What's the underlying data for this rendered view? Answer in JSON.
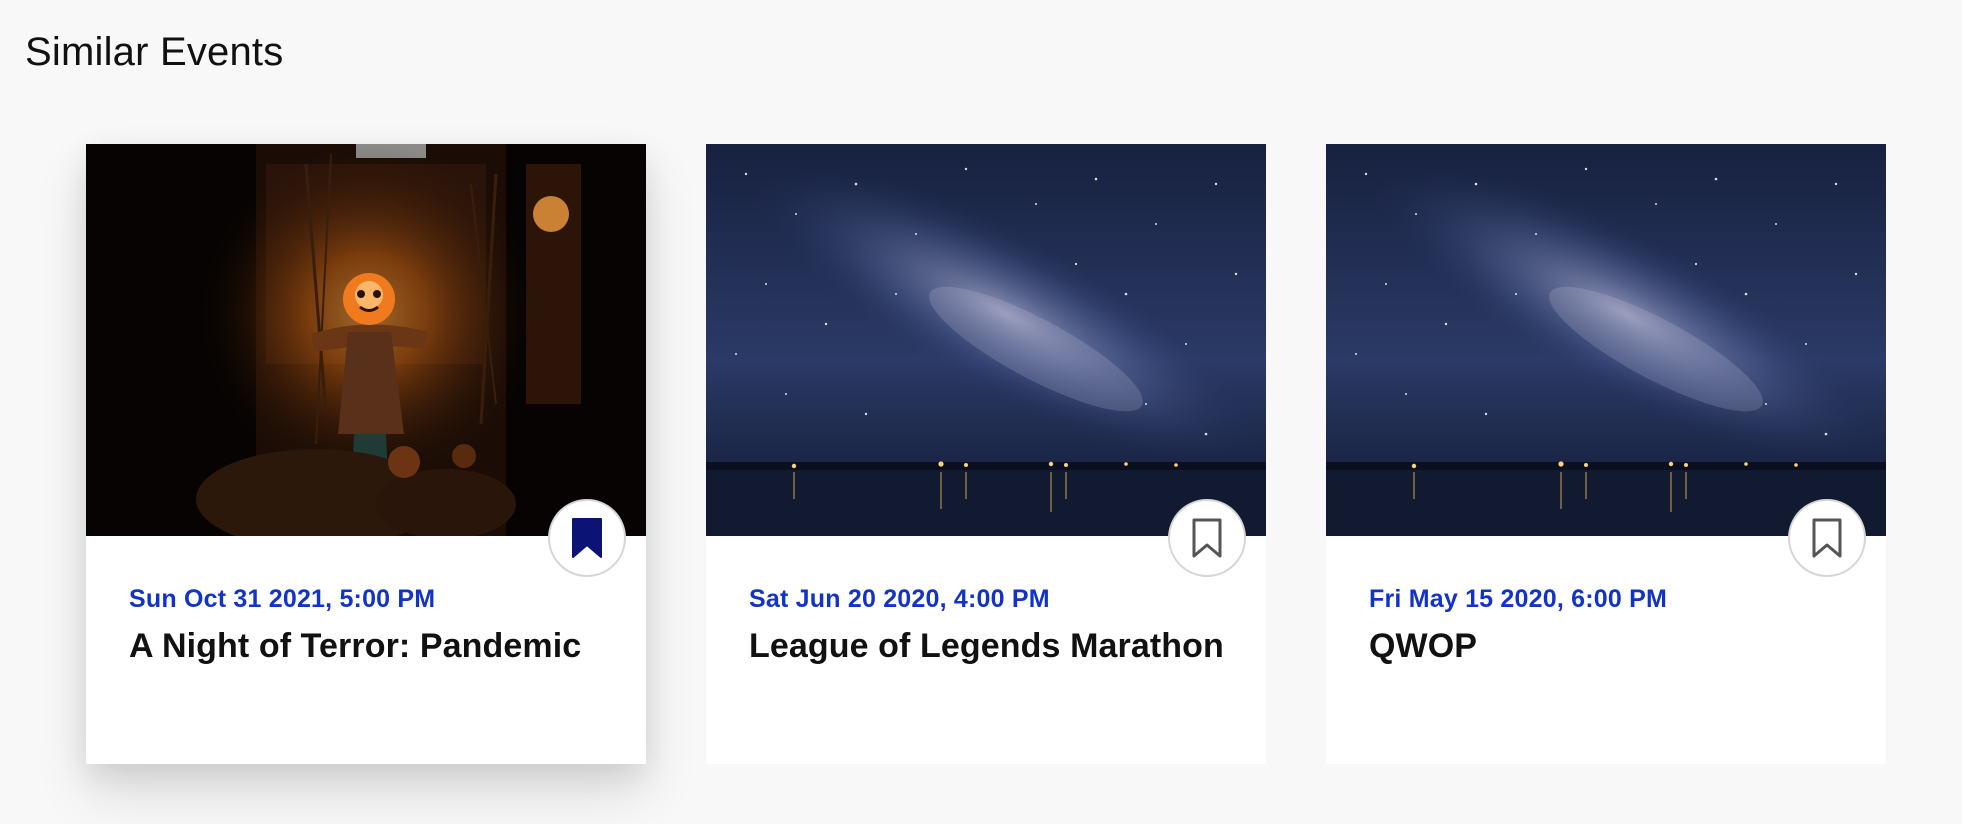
{
  "page": {
    "title": "Similar Events"
  },
  "events": [
    {
      "date": "Sun Oct 31 2021, 5:00 PM",
      "title": "A Night of Terror: Pandemic",
      "image": "halloween-scarecrow-photo",
      "bookmarked": true,
      "bookmark_icon": "bookmark-filled-icon"
    },
    {
      "date": "Sat Jun 20 2020, 4:00 PM",
      "title": "League of Legends Marathon",
      "image": "night-sky-milky-way-photo",
      "bookmarked": false,
      "bookmark_icon": "bookmark-outline-icon"
    },
    {
      "date": "Fri May 15 2020, 6:00 PM",
      "title": "QWOP",
      "image": "night-sky-milky-way-photo",
      "bookmarked": false,
      "bookmark_icon": "bookmark-outline-icon"
    }
  ],
  "colors": {
    "background": "#f8f8f8",
    "date_text": "#1233c8",
    "bookmark_filled": "#0b1475",
    "bookmark_outline": "#555555"
  }
}
